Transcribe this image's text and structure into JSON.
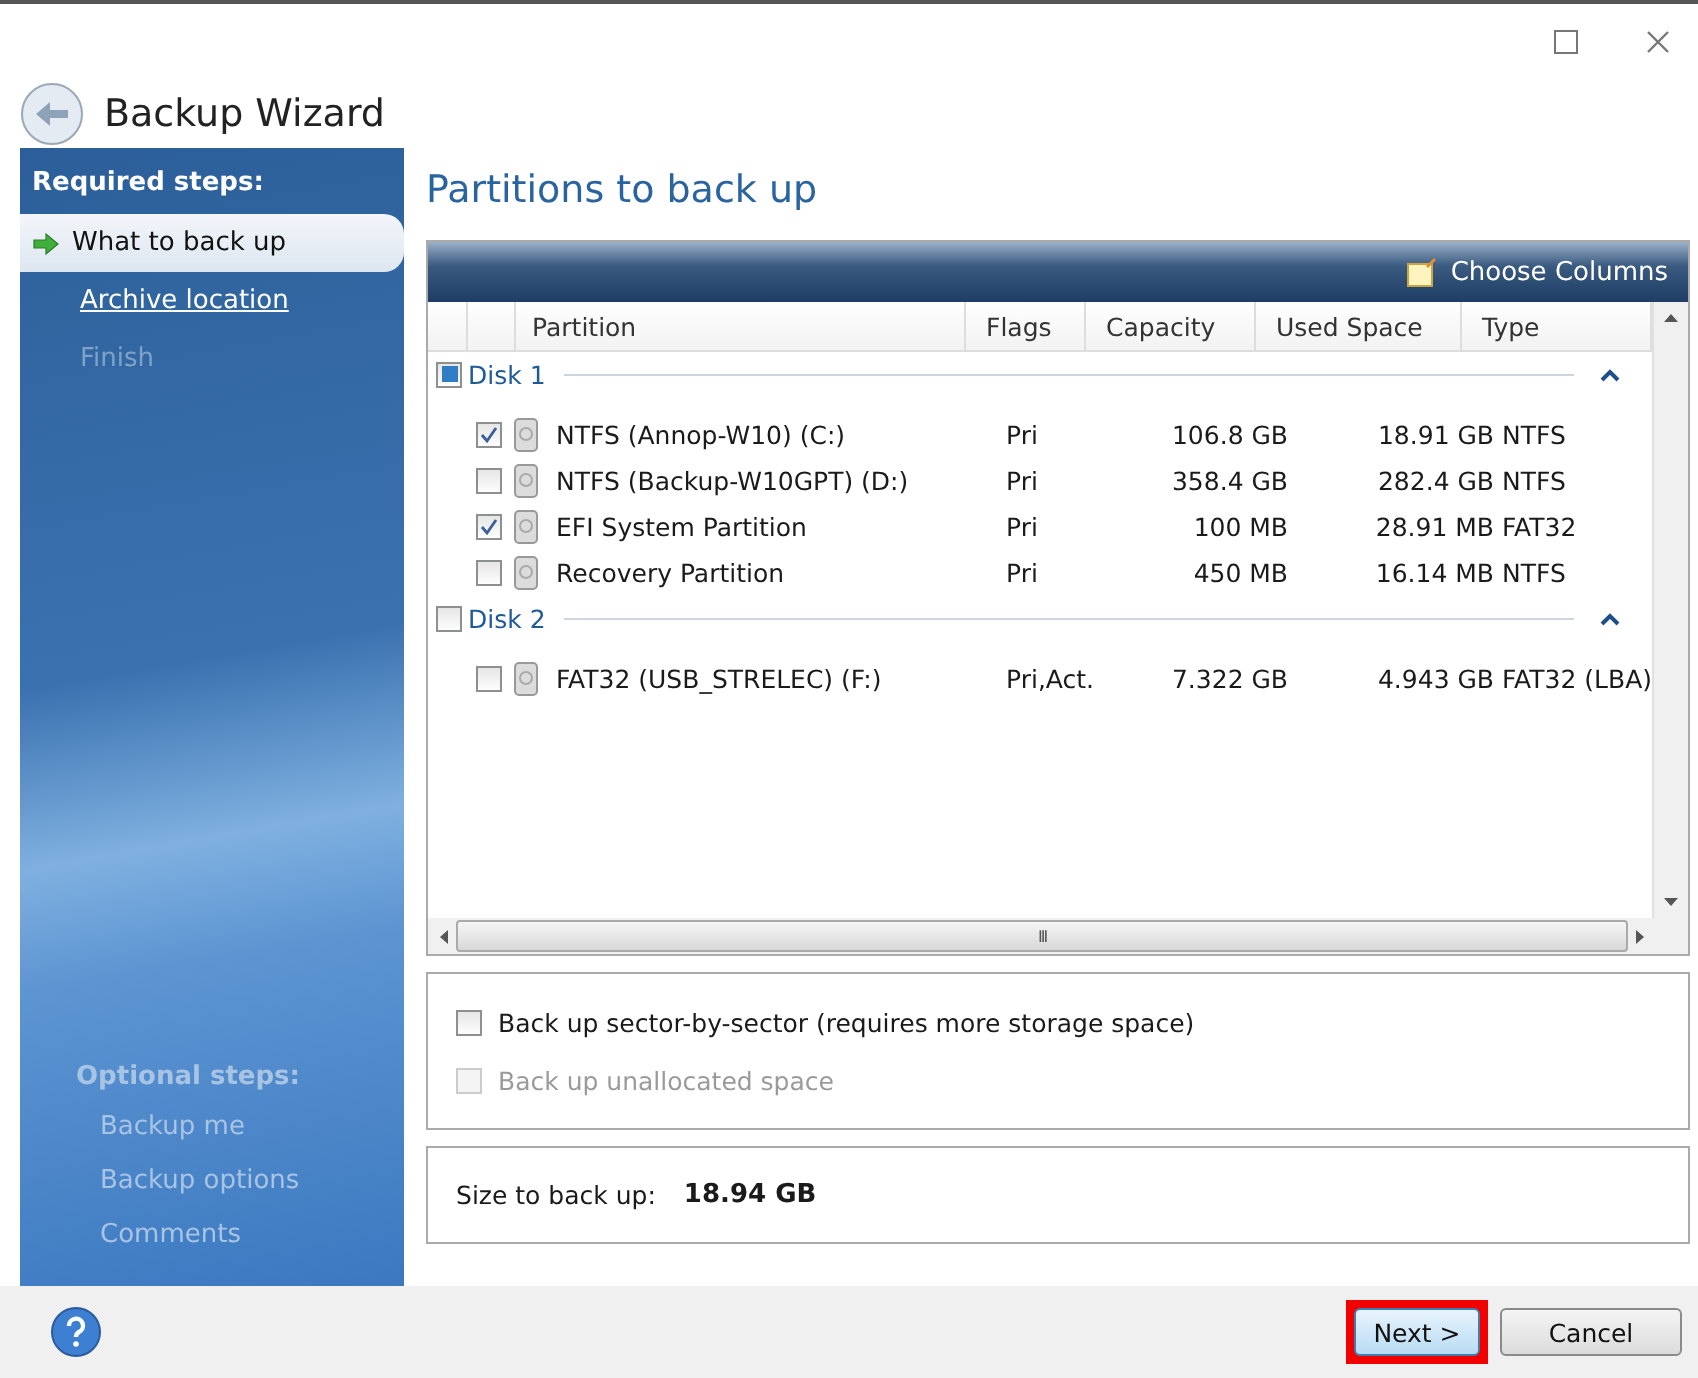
{
  "window": {
    "title": "Backup Wizard"
  },
  "sidebar": {
    "required_heading": "Required steps:",
    "required_steps": [
      {
        "label": "What to back up",
        "selected": true,
        "disabled": false
      },
      {
        "label": "Archive location",
        "selected": false,
        "disabled": false
      },
      {
        "label": "Finish",
        "selected": false,
        "disabled": true
      }
    ],
    "optional_heading": "Optional steps:",
    "optional_steps": [
      {
        "label": "Backup me"
      },
      {
        "label": "Backup options"
      },
      {
        "label": "Comments"
      }
    ]
  },
  "page_title": "Partitions to back up",
  "toolbar": {
    "choose_columns": "Choose Columns"
  },
  "table": {
    "columns": [
      "Partition",
      "Flags",
      "Capacity",
      "Used Space",
      "Type"
    ],
    "disks": [
      {
        "label": "Disk 1",
        "checked": false,
        "partial": true,
        "expanded": true,
        "partitions": [
          {
            "name": "NTFS (Annop-W10) (C:)",
            "flags": "Pri",
            "capacity": "106.8 GB",
            "used": "18.91 GB",
            "type": "NTFS",
            "checked": true
          },
          {
            "name": "NTFS (Backup-W10GPT) (D:)",
            "flags": "Pri",
            "capacity": "358.4 GB",
            "used": "282.4 GB",
            "type": "NTFS",
            "checked": false
          },
          {
            "name": "EFI System Partition",
            "flags": "Pri",
            "capacity": "100 MB",
            "used": "28.91 MB",
            "type": "FAT32",
            "checked": true
          },
          {
            "name": "Recovery Partition",
            "flags": "Pri",
            "capacity": "450 MB",
            "used": "16.14 MB",
            "type": "NTFS",
            "checked": false
          }
        ]
      },
      {
        "label": "Disk 2",
        "checked": false,
        "partial": false,
        "expanded": true,
        "partitions": [
          {
            "name": "FAT32 (USB_STRELEC) (F:)",
            "flags": "Pri,Act.",
            "capacity": "7.322 GB",
            "used": "4.943 GB",
            "type": "FAT32 (LBA)",
            "checked": false
          }
        ]
      }
    ],
    "scroll_grip": "III"
  },
  "options": [
    {
      "label": "Back up sector-by-sector (requires more storage space)",
      "checked": false,
      "disabled": false
    },
    {
      "label": "Back up unallocated space",
      "checked": false,
      "disabled": true
    }
  ],
  "size": {
    "label": "Size to back up:",
    "value": "18.94 GB"
  },
  "buttons": [
    {
      "label": "Next >",
      "highlighted": true
    },
    {
      "label": "Cancel",
      "highlighted": false
    }
  ]
}
